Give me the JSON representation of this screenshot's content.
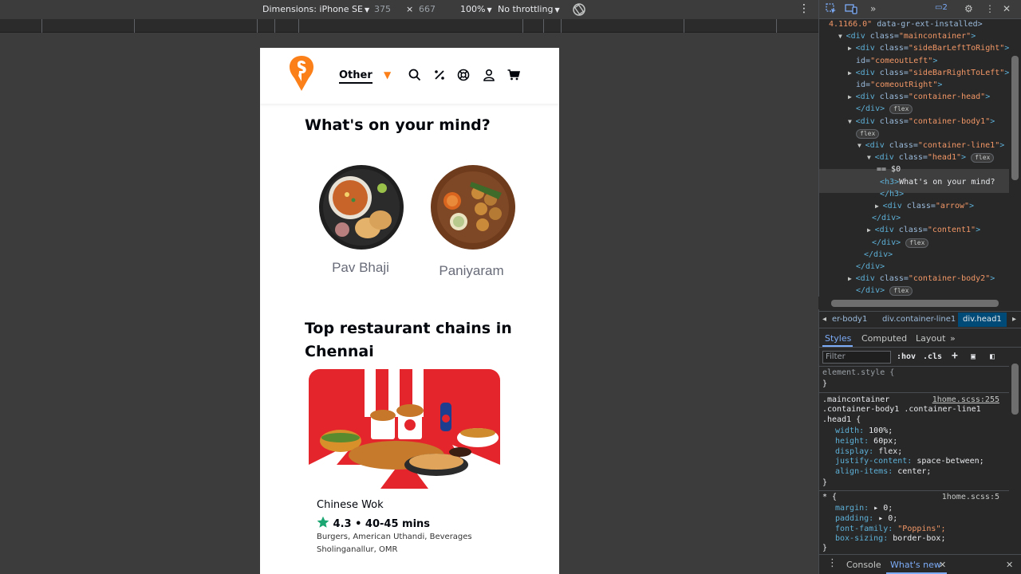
{
  "toolbar": {
    "dimensions_label": "Dimensions: iPhone SE",
    "width": "375",
    "times": "×",
    "height": "667",
    "zoom": "100%",
    "throttling": "No throttling"
  },
  "page": {
    "location_label": "Other",
    "section_mind_title": "What's on your mind?",
    "dishes": [
      {
        "name": "Pav Bhaji"
      },
      {
        "name": "Paniyaram"
      }
    ],
    "section_chains_title": "Top restaurant chains in Chennai",
    "restaurant": {
      "name": "Chinese Wok",
      "rating_line": "4.3 • 40-45 mins",
      "cuisines": "Burgers, American Uthandi, Beverages",
      "area": "Sholinganallur, OMR"
    }
  },
  "devtools": {
    "issues_count": "2",
    "elements": [
      {
        "indent": 12,
        "text_a": "4.1166.0\"",
        "text_b": " data-gr-ext-installed>"
      },
      {
        "indent": 24,
        "tag": "div",
        "attr": "class",
        "val": "maincontainer"
      },
      {
        "indent": 36,
        "tag": "div",
        "attr": "class",
        "val": "sideBarLeftToRight"
      },
      {
        "indent": 46,
        "attr": "id",
        "val": "comeoutLeft"
      },
      {
        "indent": 36,
        "tag": "div",
        "attr": "class",
        "val": "sideBarRightToLeft"
      },
      {
        "indent": 46,
        "attr": "id",
        "val": "comeoutRight"
      },
      {
        "indent": 36,
        "tag": "div",
        "attr": "class",
        "val": "container-head"
      },
      {
        "indent": 46,
        "close": "</div>",
        "pill": "flex"
      },
      {
        "indent": 36,
        "tag": "div",
        "attr": "class",
        "val": "container-body1"
      },
      {
        "indent": 46,
        "pill": "flex"
      },
      {
        "indent": 48,
        "tag": "div",
        "attr": "class",
        "val": "container-line1"
      },
      {
        "indent": 60,
        "tag": "div",
        "attr": "class",
        "val": "head1",
        "pill": "flex"
      },
      {
        "indent": 72,
        "plain": "== $0"
      },
      {
        "indent": 76,
        "open": "<h3>",
        "txt": "What's on your mind?"
      },
      {
        "indent": 76,
        "close": "</h3>"
      },
      {
        "indent": 70,
        "tag": "div",
        "attr": "class",
        "val": "arrow"
      },
      {
        "indent": 66,
        "close": "</div>"
      },
      {
        "indent": 60,
        "tag": "div",
        "attr": "class",
        "val": "content1"
      },
      {
        "indent": 66,
        "close": "</div>",
        "pill": "flex"
      },
      {
        "indent": 56,
        "close": "</div>"
      },
      {
        "indent": 46,
        "close": "</div>"
      },
      {
        "indent": 36,
        "tag": "div",
        "attr": "class",
        "val": "container-body2"
      },
      {
        "indent": 46,
        "close": "</div>",
        "pill": "flex"
      }
    ],
    "breadcrumbs": [
      "er-body1",
      "div.container-line1",
      "div.head1"
    ],
    "tabs": [
      "Styles",
      "Computed",
      "Layout"
    ],
    "filter_placeholder": "Filter",
    "filter_buttons": [
      ":hov",
      ".cls"
    ],
    "styles": {
      "element_style": "element.style {",
      "close_brace": "}",
      "rule1_selector_a": ".maincontainer",
      "rule1_selector_b": ".container-body1 .container-line1",
      "rule1_selector_c": ".head1 {",
      "rule1_source": "1home.scss:255",
      "rule1_props": [
        {
          "p": "width",
          "v": "100%;"
        },
        {
          "p": "height",
          "v": "60px;"
        },
        {
          "p": "display",
          "v": "flex;"
        },
        {
          "p": "justify-content",
          "v": "space-between;"
        },
        {
          "p": "align-items",
          "v": "center;"
        }
      ],
      "rule2_selector": "* {",
      "rule2_source": "1home.scss:5",
      "rule2_props": [
        {
          "p": "margin",
          "v": "▸ 0;"
        },
        {
          "p": "padding",
          "v": "▸ 0;"
        },
        {
          "p": "font-family",
          "v": "\"Poppins\";"
        },
        {
          "p": "box-sizing",
          "v": "border-box;"
        }
      ]
    },
    "drawer_tabs": [
      "Console",
      "What's new"
    ]
  },
  "colors": {
    "brand_orange": "#fc8019",
    "rating_green": "#1ba672",
    "kfc_red": "#e4002b",
    "devtools_bg": "#282828"
  }
}
